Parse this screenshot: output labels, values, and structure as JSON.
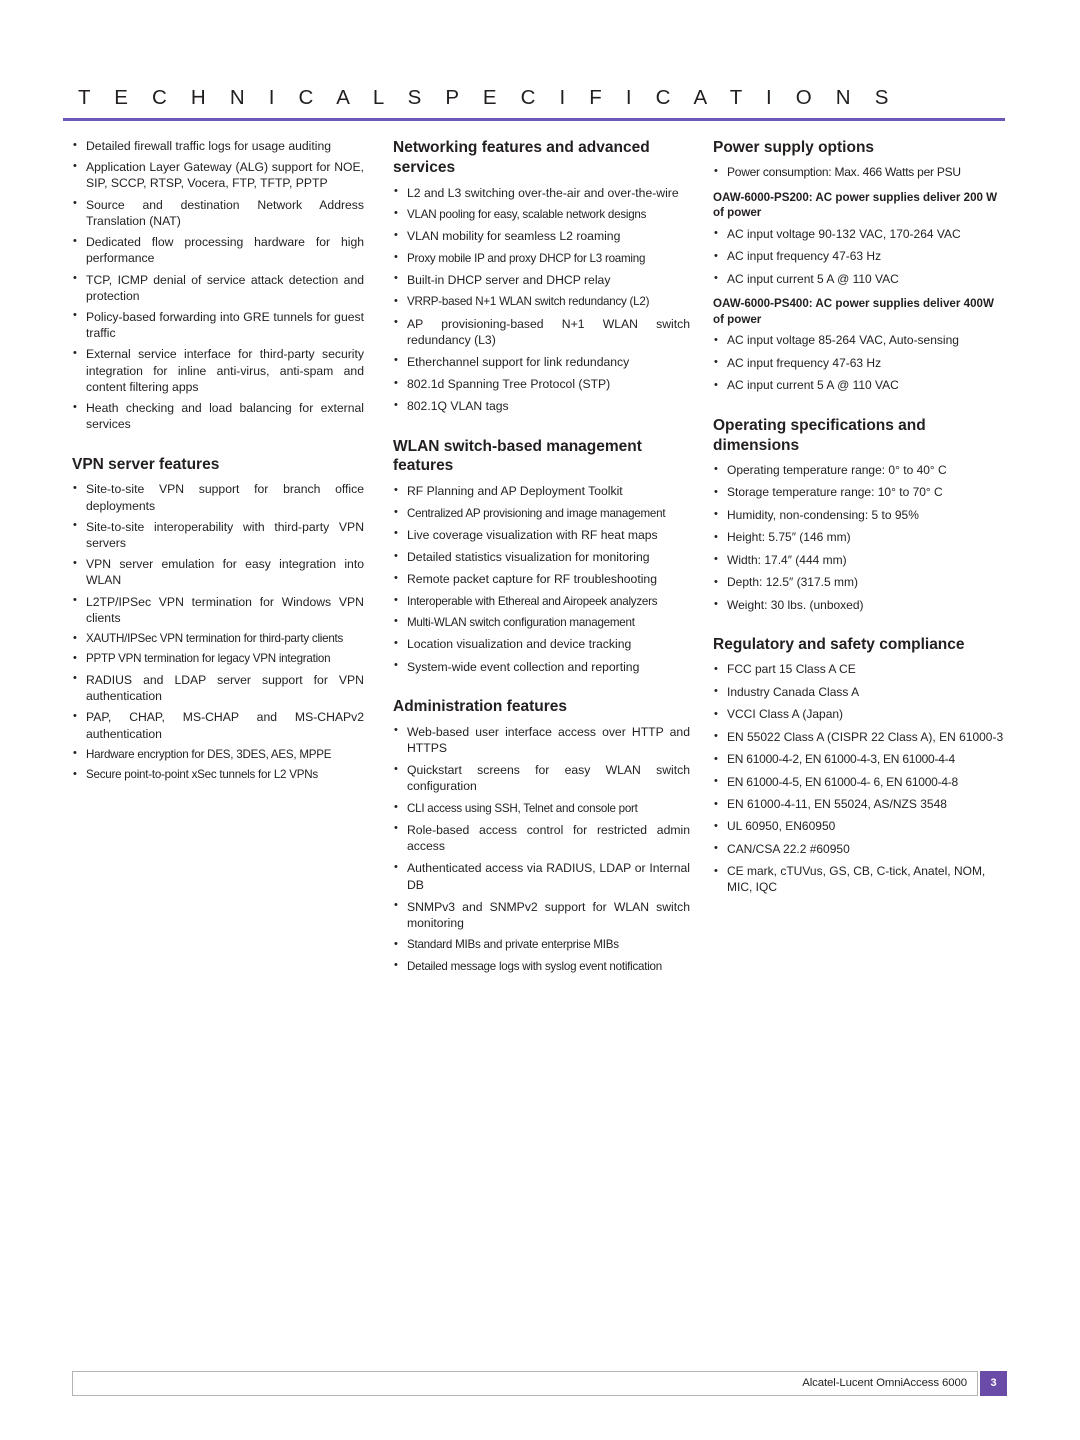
{
  "header": {
    "title": "T E C H N I C A L   S P E C I F I C A T I O N S",
    "rule_color": "#6d57b8"
  },
  "columns": {
    "col1": {
      "intro_bullets": [
        "Detailed firewall traffic logs for usage auditing",
        "Application Layer Gateway (ALG) support for NOE, SIP, SCCP, RTSP, Vocera, FTP, TFTP, PPTP",
        "Source and destination Network Address Translation (NAT)",
        "Dedicated flow processing hardware for high performance",
        "TCP, ICMP denial of service attack detection and protection",
        "Policy-based forwarding into GRE tunnels for guest traffic",
        "External service interface for third-party security integration for inline anti-virus, anti-spam and content filtering apps",
        "Heath checking and load balancing for external services"
      ],
      "vpn": {
        "heading": "VPN server features",
        "bullets": [
          "Site-to-site VPN support for branch office deployments",
          "Site-to-site interoperability with third-party VPN servers",
          "VPN server emulation for easy integration into WLAN",
          "L2TP/IPSec VPN termination for Windows VPN clients",
          "XAUTH/IPSec VPN termination for third-party clients",
          "PPTP VPN termination for legacy VPN integration",
          "RADIUS and LDAP server support for VPN authentication",
          "PAP, CHAP, MS-CHAP and MS-CHAPv2 authentication",
          "Hardware encryption for DES, 3DES, AES, MPPE",
          "Secure point-to-point xSec tunnels for L2 VPNs"
        ]
      }
    },
    "col2": {
      "networking": {
        "heading": "Networking features and advanced services",
        "bullets": [
          "L2 and L3 switching over-the-air and over-the-wire",
          "VLAN pooling for easy, scalable network designs",
          "VLAN mobility for seamless L2 roaming",
          "Proxy mobile IP and proxy DHCP for L3 roaming",
          "Built-in DHCP server and DHCP relay",
          "VRRP-based N+1 WLAN switch redundancy (L2)",
          "AP provisioning-based N+1 WLAN switch redundancy (L3)",
          "Etherchannel support for link redundancy",
          "802.1d Spanning Tree Protocol (STP)",
          "802.1Q VLAN tags"
        ]
      },
      "wlan_mgmt": {
        "heading": "WLAN switch-based management features",
        "bullets": [
          "RF Planning and AP Deployment Toolkit",
          "Centralized AP provisioning and image management",
          "Live coverage visualization with RF heat maps",
          "Detailed statistics visualization for monitoring",
          "Remote packet capture for RF troubleshooting",
          "Interoperable with Ethereal and Airopeek analyzers",
          "Multi-WLAN switch configuration management",
          "Location visualization and device tracking",
          "System-wide event collection and reporting"
        ]
      },
      "administration": {
        "heading": "Administration features",
        "bullets": [
          "Web-based user interface access over HTTP and HTTPS",
          "Quickstart screens for easy WLAN switch configuration",
          "CLI access using SSH, Telnet and console port",
          "Role-based access control for restricted admin access",
          "Authenticated access via RADIUS, LDAP or Internal DB",
          "SNMPv3 and SNMPv2 support for WLAN switch monitoring",
          "Standard MIBs and private enterprise MIBs",
          "Detailed message logs with syslog event notification"
        ]
      }
    },
    "col3": {
      "power": {
        "heading": "Power supply options",
        "bullets": [
          "Power consumption:  Max. 466 Watts per PSU"
        ],
        "ps200": {
          "subheading": "OAW-6000-PS200: AC power supplies deliver 200 W of power",
          "bullets": [
            "AC input voltage 90-132 VAC, 170-264 VAC",
            "AC input frequency 47-63 Hz",
            "AC input current 5 A @ 110 VAC"
          ]
        },
        "ps400": {
          "subheading": "OAW-6000-PS400: AC power supplies deliver 400W of power",
          "bullets": [
            "AC input voltage 85-264 VAC, Auto-sensing",
            "AC input frequency 47-63 Hz",
            "AC input current 5 A @ 110 VAC"
          ]
        }
      },
      "operating": {
        "heading": "Operating specifications and dimensions",
        "bullets": [
          "Operating temperature range: 0° to 40° C",
          "Storage temperature range: 10° to 70° C",
          "Humidity, non-condensing: 5 to 95%",
          "Height: 5.75″ (146 mm)",
          "Width: 17.4″ (444 mm)",
          "Depth: 12.5″ (317.5 mm)",
          "Weight: 30 lbs. (unboxed)"
        ]
      },
      "regulatory": {
        "heading": "Regulatory and safety compliance",
        "bullets": [
          "FCC part 15 Class A CE",
          "Industry Canada Class A",
          "VCCI Class A (Japan)",
          "EN 55022 Class A (CISPR 22 Class A), EN 61000-3",
          "EN 61000-4-2, EN 61000-4-3, EN 61000-4-4",
          "EN 61000-4-5, EN 61000-4- 6, EN 61000-4-8",
          "EN 61000-4-11, EN 55024, AS/NZS 3548",
          "UL 60950, EN60950",
          "CAN/CSA 22.2 #60950",
          "CE mark, cTUVus, GS, CB, C-tick, Anatel, NOM, MIC, IQC"
        ]
      }
    }
  },
  "footer": {
    "product": "Alcatel-Lucent OmniAccess 6000",
    "page_number": "3",
    "accent_color": "#6b4ba8"
  }
}
